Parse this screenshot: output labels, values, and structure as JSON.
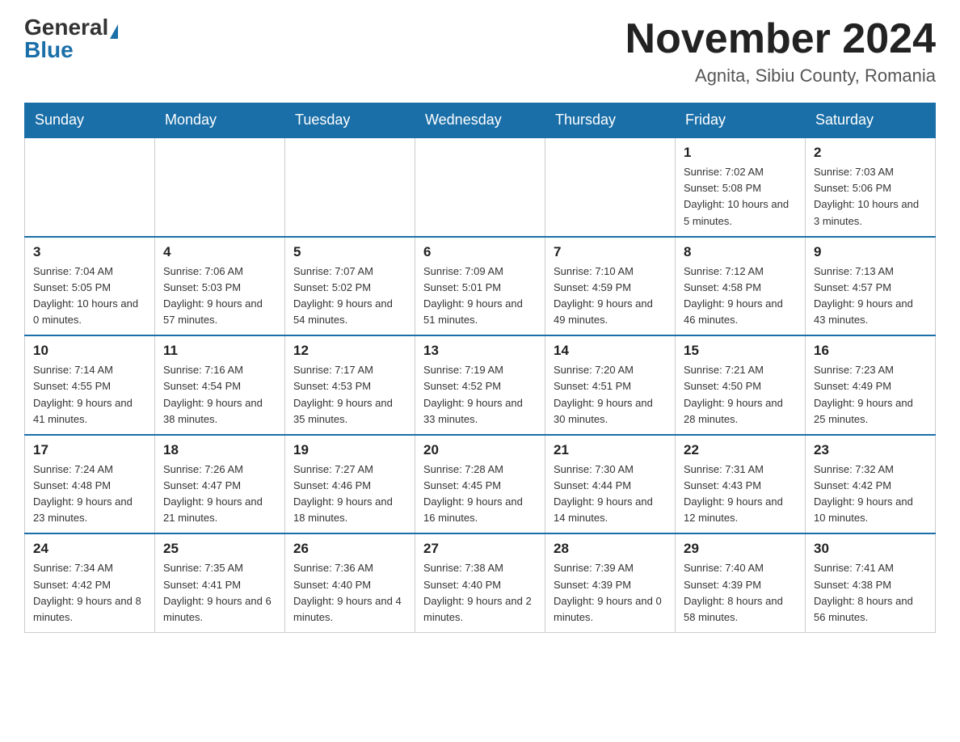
{
  "header": {
    "logo_general": "General",
    "logo_blue": "Blue",
    "month_title": "November 2024",
    "location": "Agnita, Sibiu County, Romania"
  },
  "days_of_week": [
    "Sunday",
    "Monday",
    "Tuesday",
    "Wednesday",
    "Thursday",
    "Friday",
    "Saturday"
  ],
  "weeks": [
    [
      {
        "day": "",
        "sunrise": "",
        "sunset": "",
        "daylight": ""
      },
      {
        "day": "",
        "sunrise": "",
        "sunset": "",
        "daylight": ""
      },
      {
        "day": "",
        "sunrise": "",
        "sunset": "",
        "daylight": ""
      },
      {
        "day": "",
        "sunrise": "",
        "sunset": "",
        "daylight": ""
      },
      {
        "day": "",
        "sunrise": "",
        "sunset": "",
        "daylight": ""
      },
      {
        "day": "1",
        "sunrise": "Sunrise: 7:02 AM",
        "sunset": "Sunset: 5:08 PM",
        "daylight": "Daylight: 10 hours and 5 minutes."
      },
      {
        "day": "2",
        "sunrise": "Sunrise: 7:03 AM",
        "sunset": "Sunset: 5:06 PM",
        "daylight": "Daylight: 10 hours and 3 minutes."
      }
    ],
    [
      {
        "day": "3",
        "sunrise": "Sunrise: 7:04 AM",
        "sunset": "Sunset: 5:05 PM",
        "daylight": "Daylight: 10 hours and 0 minutes."
      },
      {
        "day": "4",
        "sunrise": "Sunrise: 7:06 AM",
        "sunset": "Sunset: 5:03 PM",
        "daylight": "Daylight: 9 hours and 57 minutes."
      },
      {
        "day": "5",
        "sunrise": "Sunrise: 7:07 AM",
        "sunset": "Sunset: 5:02 PM",
        "daylight": "Daylight: 9 hours and 54 minutes."
      },
      {
        "day": "6",
        "sunrise": "Sunrise: 7:09 AM",
        "sunset": "Sunset: 5:01 PM",
        "daylight": "Daylight: 9 hours and 51 minutes."
      },
      {
        "day": "7",
        "sunrise": "Sunrise: 7:10 AM",
        "sunset": "Sunset: 4:59 PM",
        "daylight": "Daylight: 9 hours and 49 minutes."
      },
      {
        "day": "8",
        "sunrise": "Sunrise: 7:12 AM",
        "sunset": "Sunset: 4:58 PM",
        "daylight": "Daylight: 9 hours and 46 minutes."
      },
      {
        "day": "9",
        "sunrise": "Sunrise: 7:13 AM",
        "sunset": "Sunset: 4:57 PM",
        "daylight": "Daylight: 9 hours and 43 minutes."
      }
    ],
    [
      {
        "day": "10",
        "sunrise": "Sunrise: 7:14 AM",
        "sunset": "Sunset: 4:55 PM",
        "daylight": "Daylight: 9 hours and 41 minutes."
      },
      {
        "day": "11",
        "sunrise": "Sunrise: 7:16 AM",
        "sunset": "Sunset: 4:54 PM",
        "daylight": "Daylight: 9 hours and 38 minutes."
      },
      {
        "day": "12",
        "sunrise": "Sunrise: 7:17 AM",
        "sunset": "Sunset: 4:53 PM",
        "daylight": "Daylight: 9 hours and 35 minutes."
      },
      {
        "day": "13",
        "sunrise": "Sunrise: 7:19 AM",
        "sunset": "Sunset: 4:52 PM",
        "daylight": "Daylight: 9 hours and 33 minutes."
      },
      {
        "day": "14",
        "sunrise": "Sunrise: 7:20 AM",
        "sunset": "Sunset: 4:51 PM",
        "daylight": "Daylight: 9 hours and 30 minutes."
      },
      {
        "day": "15",
        "sunrise": "Sunrise: 7:21 AM",
        "sunset": "Sunset: 4:50 PM",
        "daylight": "Daylight: 9 hours and 28 minutes."
      },
      {
        "day": "16",
        "sunrise": "Sunrise: 7:23 AM",
        "sunset": "Sunset: 4:49 PM",
        "daylight": "Daylight: 9 hours and 25 minutes."
      }
    ],
    [
      {
        "day": "17",
        "sunrise": "Sunrise: 7:24 AM",
        "sunset": "Sunset: 4:48 PM",
        "daylight": "Daylight: 9 hours and 23 minutes."
      },
      {
        "day": "18",
        "sunrise": "Sunrise: 7:26 AM",
        "sunset": "Sunset: 4:47 PM",
        "daylight": "Daylight: 9 hours and 21 minutes."
      },
      {
        "day": "19",
        "sunrise": "Sunrise: 7:27 AM",
        "sunset": "Sunset: 4:46 PM",
        "daylight": "Daylight: 9 hours and 18 minutes."
      },
      {
        "day": "20",
        "sunrise": "Sunrise: 7:28 AM",
        "sunset": "Sunset: 4:45 PM",
        "daylight": "Daylight: 9 hours and 16 minutes."
      },
      {
        "day": "21",
        "sunrise": "Sunrise: 7:30 AM",
        "sunset": "Sunset: 4:44 PM",
        "daylight": "Daylight: 9 hours and 14 minutes."
      },
      {
        "day": "22",
        "sunrise": "Sunrise: 7:31 AM",
        "sunset": "Sunset: 4:43 PM",
        "daylight": "Daylight: 9 hours and 12 minutes."
      },
      {
        "day": "23",
        "sunrise": "Sunrise: 7:32 AM",
        "sunset": "Sunset: 4:42 PM",
        "daylight": "Daylight: 9 hours and 10 minutes."
      }
    ],
    [
      {
        "day": "24",
        "sunrise": "Sunrise: 7:34 AM",
        "sunset": "Sunset: 4:42 PM",
        "daylight": "Daylight: 9 hours and 8 minutes."
      },
      {
        "day": "25",
        "sunrise": "Sunrise: 7:35 AM",
        "sunset": "Sunset: 4:41 PM",
        "daylight": "Daylight: 9 hours and 6 minutes."
      },
      {
        "day": "26",
        "sunrise": "Sunrise: 7:36 AM",
        "sunset": "Sunset: 4:40 PM",
        "daylight": "Daylight: 9 hours and 4 minutes."
      },
      {
        "day": "27",
        "sunrise": "Sunrise: 7:38 AM",
        "sunset": "Sunset: 4:40 PM",
        "daylight": "Daylight: 9 hours and 2 minutes."
      },
      {
        "day": "28",
        "sunrise": "Sunrise: 7:39 AM",
        "sunset": "Sunset: 4:39 PM",
        "daylight": "Daylight: 9 hours and 0 minutes."
      },
      {
        "day": "29",
        "sunrise": "Sunrise: 7:40 AM",
        "sunset": "Sunset: 4:39 PM",
        "daylight": "Daylight: 8 hours and 58 minutes."
      },
      {
        "day": "30",
        "sunrise": "Sunrise: 7:41 AM",
        "sunset": "Sunset: 4:38 PM",
        "daylight": "Daylight: 8 hours and 56 minutes."
      }
    ]
  ]
}
